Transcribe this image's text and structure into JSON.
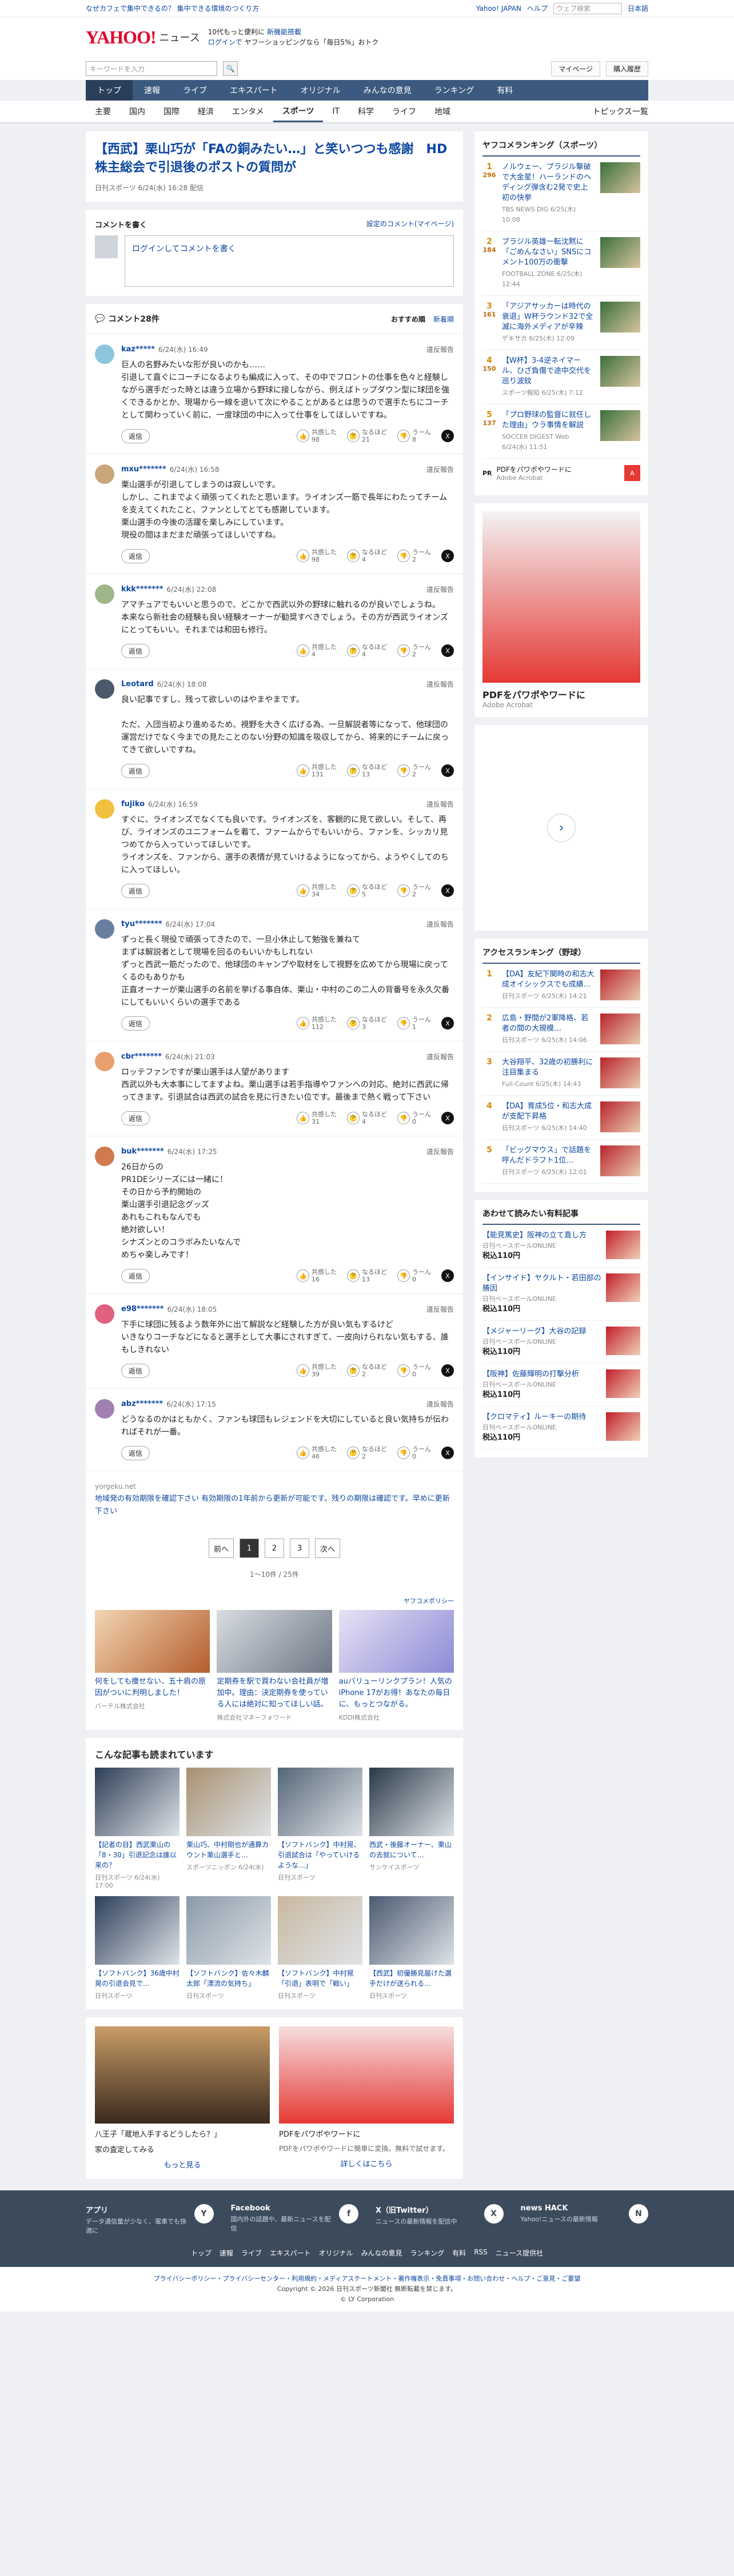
{
  "topbar": {
    "left": "なぜカフェで集中できるの？ 集中できる環境のつくり方",
    "right1": "Yahoo! JAPAN",
    "right2": "ヘルプ",
    "search_placeholder": "ウェブ検索",
    "flag": "日本語"
  },
  "header": {
    "logo": "YAHOO!",
    "logo_sub": "JAPAN",
    "news": "ニュース",
    "promo1": "10代もっと便利に",
    "promo1b": "新機能搭載",
    "promo2": "ログインで",
    "promo2b": "ヤフーショッピングなら「毎日5%」おトク"
  },
  "search": {
    "placeholder": "キーワードを入力",
    "btn": "検索",
    "right": [
      "マイページ",
      "購入履歴"
    ]
  },
  "nav": [
    "トップ",
    "速報",
    "ライブ",
    "エキスパート",
    "オリジナル",
    "みんなの意見",
    "ランキング",
    "有料"
  ],
  "subnav": [
    "主要",
    "国内",
    "国際",
    "経済",
    "エンタメ",
    "スポーツ",
    "IT",
    "科学",
    "ライフ",
    "地域"
  ],
  "subnav_right": "トピックス一覧",
  "article": {
    "title": "【西武】栗山巧が「FAの銅みたい…」と笑いつつも感謝　HD株主総会で引退後のポストの質問が",
    "meta": "日刊スポーツ 6/24(水) 16:28 配信"
  },
  "form": {
    "title": "コメントを書く",
    "right": "設定のコメント(マイページ)",
    "placeholder": "ログインしてコメントを書く"
  },
  "comments": {
    "title": "コメント28件",
    "sort1": "おすすめ順",
    "sort2": "新着順",
    "items": [
      {
        "user": "kaz*****",
        "time": "6/24(水) 16:49",
        "text": "巨人の名野みたいな形が良いのかも……\n引退して直ぐにコーチになるよりも編成に入って、その中でフロントの仕事を色々と経験しながら選手だった時とは違う立場から野球に接しながら、例えばトップダウン型に球団を強くできるかとか、現場から一線を退いて次にやることがあるとは思うので選手たちにコーチとして関わっていく前に、一度球団の中に入って仕事をしてほしいですね。",
        "counts": [
          "98",
          "21",
          "8"
        ],
        "color": "#8ec6e0"
      },
      {
        "user": "mxu*******",
        "time": "6/24(水) 16:58",
        "text": "栗山選手が引退してしまうのは寂しいです。\nしかし、これまでよく頑張ってくれたと思います。ライオンズ一筋で長年にわたってチームを支えてくれたこと、ファンとしてとても感謝しています。\n栗山選手の今後の活躍を楽しみにしています。\n現役の間はまだまだ頑張ってほしいですね。",
        "counts": [
          "98",
          "4",
          "2"
        ],
        "color": "#c9a77a"
      },
      {
        "user": "kkk*******",
        "time": "6/24(水) 22:08",
        "text": "アマチュアでもいいと思うので、どこかで西武以外の野球に触れるのが良いでしょうね。\n本来なら新社会の経験も良い経験オーナーが勧奨すべきでしょう。その方が西武ライオンズにとってもいい。それまでは和田も修行。",
        "counts": [
          "4",
          "4",
          "2"
        ],
        "color": "#9fb58a"
      },
      {
        "user": "Leotard",
        "time": "6/24(水) 18:08",
        "text": "良い記事ですし、残って欲しいのはやまやまです。\n\nただ、入団当初より進めるため、視野を大きく広げる為、一旦解説者等になって、他球団の運営だけでなく今までの見たことのない分野の知識を吸収してから、将来的にチームに戻ってきて欲しいですね。",
        "counts": [
          "131",
          "13",
          "2"
        ],
        "color": "#4a5a6a"
      },
      {
        "user": "fujiko",
        "time": "6/24(水) 16:59",
        "text": "すぐに、ライオンズでなくても良いです。ライオンズを、客観的に見て欲しい。そして、再び、ライオンズのユニフォームを着て、ファームからでもいいから、ファンを、シッカリ見つめてから入っていってほしいです。\nライオンズを、ファンから、選手の表情が見ていけるようになってから、ようやくしてのちに入ってほしい。",
        "counts": [
          "34",
          "5",
          "2"
        ],
        "color": "#f0c040"
      },
      {
        "user": "tyu*******",
        "time": "6/24(水) 17:04",
        "text": "ずっと長く現役で頑張ってきたので、一旦小休止して勉強を兼ねて\nまずは解説者として現場を回るのもいいかもしれない\nずっと西武一筋だったので、他球団のキャンプや取材をして視野を広めてから現場に戻ってくるのもありかも\n正直オーナーが栗山選手の名前を挙げる事自体、栗山・中村のこの二人の背番号を永久欠番にしてもいいくらいの選手である",
        "counts": [
          "112",
          "3",
          "1"
        ],
        "color": "#6a7fa0"
      },
      {
        "user": "cbr*******",
        "time": "6/24(水) 21:03",
        "text": "ロッテファンですが栗山選手は人望があります\n西武以外も大本事にしてますよね。栗山選手は若手指導やファンへの対応、絶対に西武に帰ってきます。引退試合は西武の試合を見に行きたい位です。最後まで熱く戦って下さい",
        "counts": [
          "31",
          "4",
          "0"
        ],
        "color": "#e8a070"
      },
      {
        "user": "buk*******",
        "time": "6/24(水) 17:25",
        "text": "26日からの\nPR1DEシリーズには一緒に！\nその日から予約開始の\n栗山選手引退記念グッズ\nあれもこれもなんでも\n絶対欲しい！\nシナズンとのコラボみたいなんで\nめちゃ楽しみです！",
        "counts": [
          "16",
          "13",
          "0"
        ],
        "color": "#d07a50"
      },
      {
        "user": "e98*******",
        "time": "6/24(水) 18:05",
        "text": "下手に球団に残るよう数年外に出て解説など経験した方が良い気もするけど\nいきなりコーチなどになると選手として大事にされすぎて、一皮向けられない気もする、誰もしきれない",
        "counts": [
          "39",
          "2",
          "0"
        ],
        "color": "#e06080"
      },
      {
        "user": "abz*******",
        "time": "6/24(水) 17:15",
        "text": "どうなるのかはともかく、ファンも球団もレジェンドを大切にしていると良い気持ちが伝わればそれが一番。",
        "counts": [
          "46",
          "2",
          "0"
        ],
        "color": "#a080b0"
      }
    ],
    "labels": {
      "reply": "返信",
      "good": "共感した",
      "idk": "なるほど",
      "bad": "うーん",
      "report": "違反報告"
    }
  },
  "notice": {
    "src": "yorgeku.net",
    "text": "地域発の有効期限を確認下さい 有効期限の1年前から更新が可能です。残りの期限は確認です。早めに更新下さい"
  },
  "pager": {
    "prev": "前へ",
    "pages": [
      "1",
      "2",
      "3"
    ],
    "next": "次へ",
    "count": "1〜10件 / 25件"
  },
  "ads": {
    "label": "ヤフコメポリシー",
    "items": [
      {
        "title": "何をしても痩せない、五十肩の原因がついに判明しました！",
        "sponsor": "バーテル株式会社"
      },
      {
        "title": "定期券を駅で買わない会社員が増加中。理由：決定期券を使っている人には絶対に知ってほしい話。",
        "sponsor": "株式会社マネーフォワード"
      },
      {
        "title": "auバリューリンクプラン！人気のiPhone 17がお得！あなたの毎日に、もっとつながる。",
        "sponsor": "KDDI株式会社"
      }
    ]
  },
  "related": {
    "title": "こんな記事も読まれています",
    "items": [
      {
        "title": "【記者の目】西武栗山の「8・30」引退記念は誰以来の？",
        "src": "日刊スポーツ 6/24(水) 17:00"
      },
      {
        "title": "栗山巧、中村剛也が通算カウント栗山選手と…",
        "src": "スポーツニッポン 6/24(水)"
      },
      {
        "title": "【ソフトバンク】中村晃、引退試合は「やっていけるような…」",
        "src": "日刊スポーツ"
      },
      {
        "title": "西武・後藤オーナー、栗山の去就について…",
        "src": "サンケイスポーツ"
      },
      {
        "title": "【ソフトバンク】36歳中村晃の引退会見で…",
        "src": "日刊スポーツ"
      },
      {
        "title": "【ソフトバンク】佐々木麟太郎「漂流の気持ち」",
        "src": "日刊スポーツ"
      },
      {
        "title": "【ソフトバンク】中村晃「引退」表明で「戦い」",
        "src": "日刊スポーツ"
      },
      {
        "title": "【西武】初優勝見届けた選手だけが送られる…",
        "src": "日刊スポーツ"
      }
    ]
  },
  "bottom_ads": [
    {
      "title": "八王子「蔵地入手するどうしたら？」",
      "sub": "家の査定してみる",
      "btn": "もっと見る"
    },
    {
      "title": "PDFをパワポやワードに",
      "sub": "PDFをパワポやワードに簡単に変換。無料で試せます。",
      "btn": "詳しくはこちら"
    }
  ],
  "ranking": {
    "title": "ヤフコメランキング（スポーツ）",
    "items": [
      {
        "n": "1",
        "v": "296",
        "title": "ノルウェー、ブラジル撃破で大金星！ハーランドのヘディング弾含む2発で史上初の快挙",
        "m": "TBS NEWS DIG 6/25(木) 10:08"
      },
      {
        "n": "2",
        "v": "184",
        "title": "ブラジル英雄一転沈黙に「ごめんなさい」SNSにコメント100万の衝撃",
        "m": "FOOTBALL ZONE 6/25(木) 12:44"
      },
      {
        "n": "3",
        "v": "161",
        "title": "「アジアサッカーは時代の衰退」W杯ラウンド32で全滅に海外メディアが辛辣",
        "m": "ゲキサカ 6/25(木) 12:09"
      },
      {
        "n": "4",
        "v": "150",
        "title": "【W杯】3-4逆ネイマール、ひざ負傷で途中交代を巡り波紋",
        "m": "スポーツ報知 6/25(木) 7:12"
      },
      {
        "n": "5",
        "v": "137",
        "title": "「プロ野球の監督に就任した理由」ウラ事情を解説",
        "m": "SOCCER DIGEST Web 6/24(水) 11:51"
      }
    ]
  },
  "pr": {
    "tag": "PR",
    "title": "PDFをパワポやワードに",
    "sponsor": "Adobe Acrobat"
  },
  "bigad": {
    "title": "PDFをパワポやワードに",
    "sponsor": "Adobe Acrobat"
  },
  "access": {
    "title": "アクセスランキング（野球）",
    "items": [
      {
        "n": "1",
        "title": "【DA】友紀下関時の和志大成オイシックスでも成績…",
        "m": "日刊スポーツ 6/25(木) 14:21"
      },
      {
        "n": "2",
        "title": "広島・野間が2軍降格、若者の間の大規模…",
        "m": "日刊スポーツ 6/25(木) 14:06"
      },
      {
        "n": "3",
        "title": "大谷翔平、32歳の初勝利に注目集まる",
        "m": "Full-Count 6/25(木) 14:43"
      },
      {
        "n": "4",
        "title": "【DA】育成5位・和志大成が支配下昇格",
        "m": "日刊スポーツ 6/25(木) 14:40"
      },
      {
        "n": "5",
        "title": "「ビッグマウス」で話題を呼んだドラフト1位…",
        "m": "日刊スポーツ 6/25(木) 12:01"
      }
    ]
  },
  "reco": {
    "title": "あわせて読みたい有料記事",
    "items": [
      {
        "title": "【能見篤史】阪神の立て直し方",
        "m": "日刊ベースボールONLINE",
        "p": "税込110円"
      },
      {
        "title": "【インサイド】ヤクルト・若田部の勝因",
        "m": "日刊ベースボールONLINE",
        "p": "税込110円"
      },
      {
        "title": "【メジャーリーグ】大谷の記録",
        "m": "日刊ベースボールONLINE",
        "p": "税込110円"
      },
      {
        "title": "【阪神】佐藤輝明の打撃分析",
        "m": "日刊ベースボールONLINE",
        "p": "税込110円"
      },
      {
        "title": "【クロマティ】ルーキーの期待",
        "m": "日刊ベースボールONLINE",
        "p": "税込110円"
      }
    ]
  },
  "footer": {
    "cols": [
      {
        "t": "アプリ",
        "s": "データ通信量が少なく、電車でも快適に",
        "ic": "Y"
      },
      {
        "t": "Facebook",
        "s": "国内外の話題や、最新ニュースを配信",
        "ic": "f"
      },
      {
        "t": "X（旧Twitter）",
        "s": "ニュースの最新情報を配信中",
        "ic": "X"
      },
      {
        "t": "news HACK",
        "s": "Yahoo!ニュースの最新情報",
        "ic": "N"
      }
    ],
    "nav": [
      "トップ",
      "速報",
      "ライブ",
      "エキスパート",
      "オリジナル",
      "みんなの意見",
      "ランキング",
      "有料",
      "RSS",
      "ニュース提供社"
    ],
    "links": "プライバシーポリシー・プライバシーセンター・利用規約・メディアステートメント・著作権表示・免責事項・お問い合わせ・ヘルプ・ご意見・ご要望",
    "copy": "Copyright © 2026 日刊スポーツ新聞社 無断転載を禁じます。",
    "corp": "© LY Corporation"
  },
  "colors": {
    "nav": "#3c5a7f",
    "link": "#0d47a1"
  }
}
